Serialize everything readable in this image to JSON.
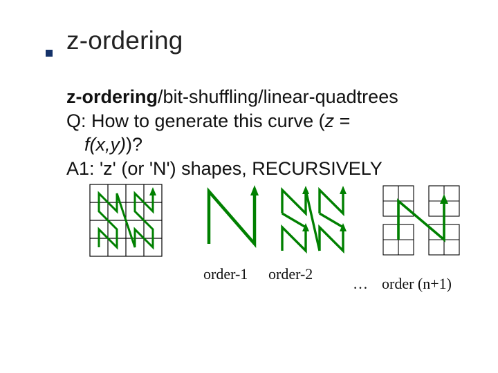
{
  "title": "z-ordering",
  "body": {
    "l1_bold": "z-ordering",
    "l1_rest": "/bit-shuffling/linear-quadtrees",
    "l2_a": "Q: How to generate this curve (",
    "l2_z": "z",
    "l2_eq": " =",
    "l3_f": "f(x,y)",
    "l3_rest": ")?",
    "l4": "A1: 'z' (or 'N') shapes, RECURSIVELY"
  },
  "captions": {
    "order1": "order-1",
    "order2": "order-2",
    "dots": "…",
    "ordern": "order (n+1)"
  },
  "colors": {
    "curve": "#008000",
    "bullet": "#153269"
  }
}
